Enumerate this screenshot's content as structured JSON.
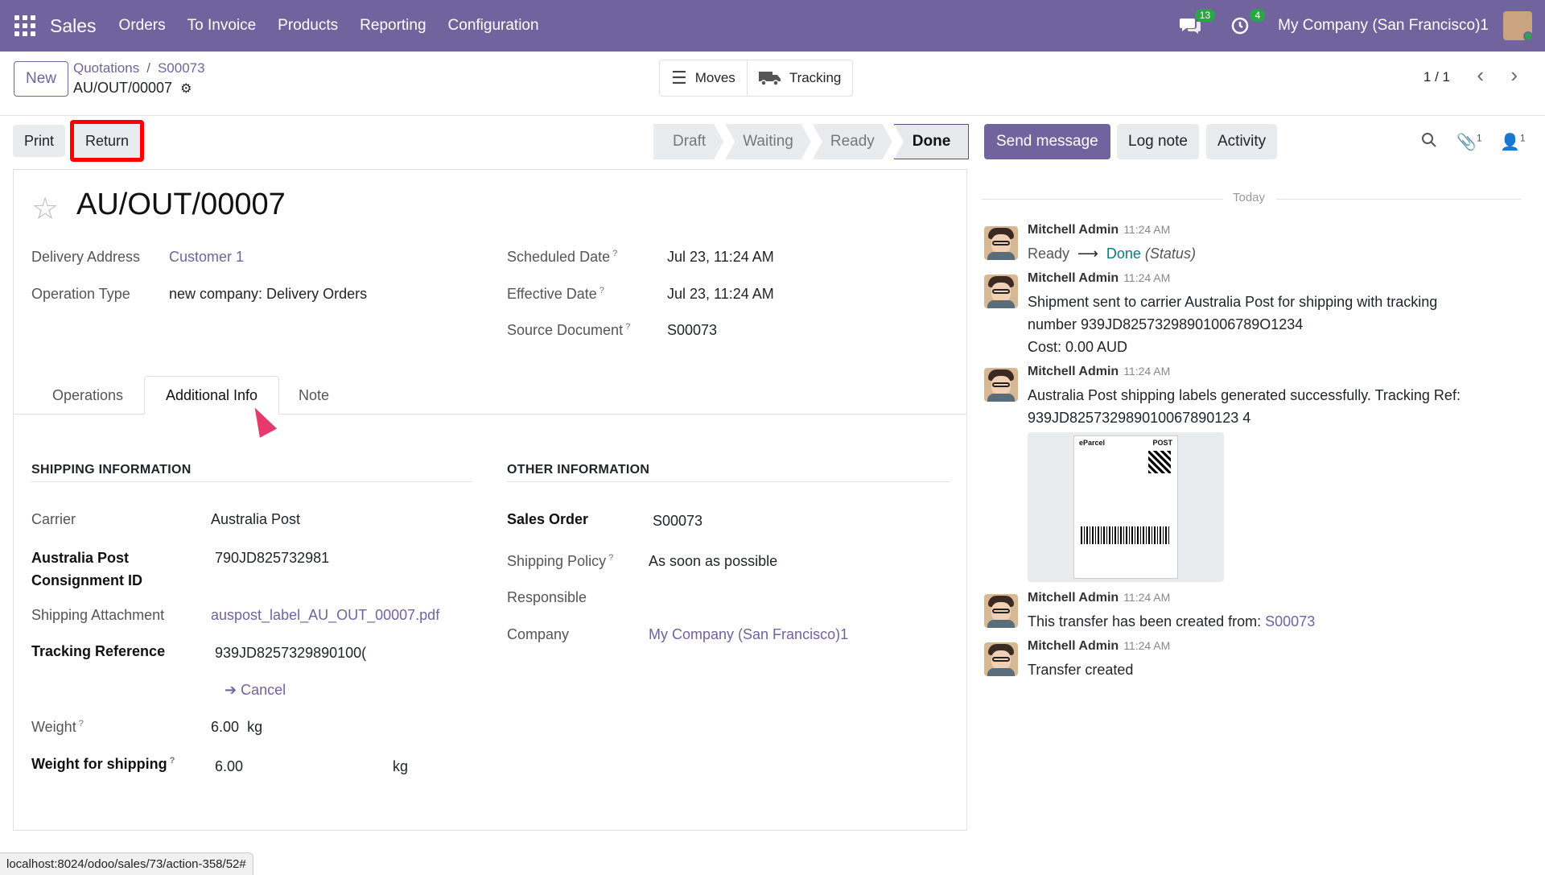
{
  "navbar": {
    "app_name": "Sales",
    "menu": [
      "Orders",
      "To Invoice",
      "Products",
      "Reporting",
      "Configuration"
    ],
    "messages_badge": "13",
    "activities_badge": "4",
    "company": "My Company (San Francisco)1"
  },
  "control": {
    "new_label": "New",
    "breadcrumb": [
      "Quotations",
      "S00073"
    ],
    "record_name": "AU/OUT/00007",
    "smart_buttons": {
      "moves": "Moves",
      "tracking": "Tracking"
    },
    "pager": "1 / 1"
  },
  "actions": {
    "print": "Print",
    "return": "Return"
  },
  "statusbar": [
    "Draft",
    "Waiting",
    "Ready",
    "Done"
  ],
  "form": {
    "title": "AU/OUT/00007",
    "delivery_address_label": "Delivery Address",
    "delivery_address": "Customer 1",
    "operation_type_label": "Operation Type",
    "operation_type": "new company: Delivery Orders",
    "scheduled_date_label": "Scheduled Date",
    "scheduled_date": "Jul 23, 11:24 AM",
    "effective_date_label": "Effective Date",
    "effective_date": "Jul 23, 11:24 AM",
    "source_document_label": "Source Document",
    "source_document": "S00073",
    "tabs": [
      "Operations",
      "Additional Info",
      "Note"
    ],
    "shipping_title": "SHIPPING INFORMATION",
    "other_title": "OTHER INFORMATION",
    "carrier_label": "Carrier",
    "carrier": "Australia Post",
    "consignment_label_1": "Australia Post",
    "consignment_label_2": "Consignment ID",
    "consignment": "790JD825732981",
    "attachment_label": "Shipping Attachment",
    "attachment": "auspost_label_AU_OUT_00007.pdf",
    "tracking_label": "Tracking Reference",
    "tracking": "939JD8257329890100(",
    "cancel": "Cancel",
    "weight_label": "Weight",
    "weight": "6.00",
    "weight_unit": "kg",
    "weight_ship_label": "Weight for shipping",
    "weight_ship": "6.00",
    "weight_ship_unit": "kg",
    "sales_order_label": "Sales Order",
    "sales_order": "S00073",
    "shipping_policy_label": "Shipping Policy",
    "shipping_policy": "As soon as possible",
    "responsible_label": "Responsible",
    "company_label": "Company",
    "company": "My Company (San Francisco)1"
  },
  "chatter": {
    "send_message": "Send message",
    "log_note": "Log note",
    "activity": "Activity",
    "attachments_count": "1",
    "followers_count": "1",
    "today": "Today",
    "messages": [
      {
        "author": "Mitchell Admin",
        "time": "11:24 AM",
        "from": "Ready",
        "to": "Done",
        "field": "(Status)"
      },
      {
        "author": "Mitchell Admin",
        "time": "11:24 AM",
        "line1": "Shipment sent to carrier Australia Post for shipping with tracking",
        "line2": "number 939JD82573298901006789O1234",
        "line3": "Cost: 0.00 AUD"
      },
      {
        "author": "Mitchell Admin",
        "time": "11:24 AM",
        "line1": "Australia Post shipping labels generated successfully. Tracking Ref:",
        "line2": "939JD825732989010067890123 4"
      },
      {
        "author": "Mitchell Admin",
        "time": "11:24 AM",
        "text": "This transfer has been created from:",
        "link": "S00073"
      },
      {
        "author": "Mitchell Admin",
        "time": "11:24 AM",
        "text": "Transfer created"
      }
    ],
    "label_brand": "eParcel",
    "label_post": "POST"
  },
  "status_url": "localhost:8024/odoo/sales/73/action-358/52#"
}
